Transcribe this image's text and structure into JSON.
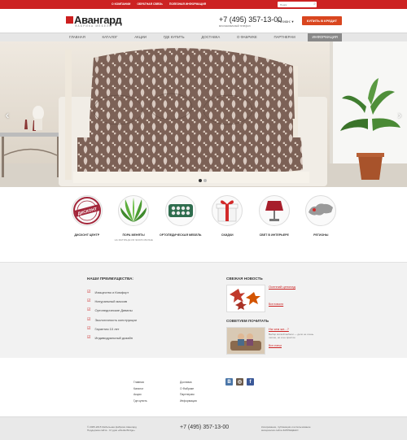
{
  "topbar": {
    "links": [
      "О КОМПАНИИ",
      "ОБРАТНАЯ СВЯЗЬ",
      "ПОЛЕЗНАЯ ИНФОРМАЦИЯ"
    ],
    "search_placeholder": "Поиск"
  },
  "header": {
    "logo_name": "Авангард",
    "logo_sub": "ФАБРИКА МЕБЕЛИ",
    "phone": "+7 (495) 357-13-00",
    "phone_caption": "многоканальный телефон",
    "region": "Регион:",
    "credit_button": "КУПИТЬ В КРЕДИТ"
  },
  "nav": {
    "items": [
      "ГЛАВНАЯ",
      "КАТАЛОГ",
      "АКЦИИ",
      "ГДЕ КУПИТЬ",
      "ДОСТАВКА",
      "О ФАБРИКЕ",
      "ПАРТНЕРАМ",
      "ИНФОРМАЦИЯ"
    ],
    "active_index": 7
  },
  "slider": {
    "prev": "‹",
    "next": "›",
    "slide_count": 2,
    "current": 0
  },
  "categories": [
    {
      "label": "ДИСКОНТ ЦЕНТР",
      "sub": "",
      "icon": "discount-stamp-icon",
      "stamp": "ДИСКОНТ"
    },
    {
      "label": "ПОРА МЕНЯТЬ!",
      "sub": "НА МАТРАЦЫ ИЗ ЭКОЛО-ВОЛНЕ",
      "icon": "aloe-leaf-icon"
    },
    {
      "label": "ОРТОПЕДИЧЕСКАЯ МЕБЕЛЬ",
      "sub": "",
      "icon": "mattress-coil-icon"
    },
    {
      "label": "СКИДКИ",
      "sub": "",
      "icon": "gift-box-icon"
    },
    {
      "label": "СВЕТ В ИНТЕРЬЕРЕ",
      "sub": "",
      "icon": "lamp-icon"
    },
    {
      "label": "РЕГИОНЫ",
      "sub": "",
      "icon": "russia-map-icon"
    }
  ],
  "advantages": {
    "title": "НАШИ ПРЕИМУЩЕСТВА:",
    "items": [
      "Изящество и Комфорт",
      "Натуральный массив",
      "Ортопедические Диваны",
      "Экологичность конструкции",
      "Гарантия 10 лет",
      "Индивидуальный дизайн"
    ]
  },
  "news": {
    "title": "СВЕЖАЯ НОВОСТЬ",
    "item_title": "Осенний ценопад",
    "more": "Все новости"
  },
  "reading": {
    "title": "СОВЕТУЕМ ПОЧИТАТЬ",
    "item_title": "На чем же...?",
    "desc": "Выбор мягкой мебели — дело не очень легкое, но и не простое",
    "more": "Все статьи"
  },
  "footer_nav": {
    "col1": [
      "Главная",
      "Каталог",
      "Акции",
      "Где купить"
    ],
    "col2": [
      "Доставка",
      "О Фабрике",
      "Партнерам",
      "Информация"
    ]
  },
  "social": [
    {
      "name": "vk-icon",
      "glyph": "В",
      "color": "#4a76a8"
    },
    {
      "name": "instagram-icon",
      "glyph": "◎",
      "color": "#6b5a4a"
    },
    {
      "name": "facebook-icon",
      "glyph": "f",
      "color": "#3b5998"
    }
  ],
  "bottom": {
    "copyright_1": "© 2005-2015 Мебельная фабрика Авангард",
    "copyright_2": "Поддержка сайта - Студия «Media Bridge»",
    "phone": "+7 (495) 357-13-00",
    "note_1": "Копирование, публикация и использование",
    "note_2": "материалов сайта ЗАПРЕЩЕНО"
  }
}
